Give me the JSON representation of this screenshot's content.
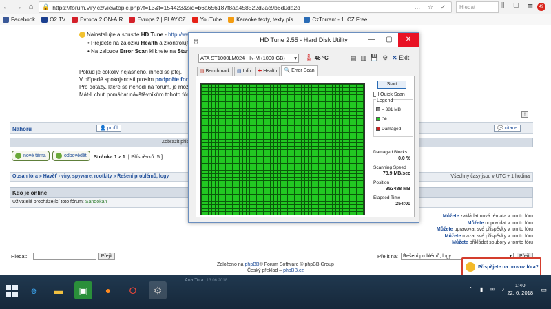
{
  "browser": {
    "url": "https://forum.viry.cz/viewtopic.php?f=13&t=154423&sid=b6a656187f8aa458522d2ac9b6d0da2d",
    "search_placeholder": "Hledat",
    "notification_count": "49"
  },
  "bookmarks": [
    {
      "label": "Facebook",
      "color": "#3b5998"
    },
    {
      "label": "O2 TV",
      "color": "#1b3f8f"
    },
    {
      "label": "Evropa 2 ON-AIR",
      "color": "#d4202a"
    },
    {
      "label": "Evropa 2 | PLAY.CZ",
      "color": "#d4202a"
    },
    {
      "label": "YouTube",
      "color": "#e62117"
    },
    {
      "label": "Karaoke texty, texty pís...",
      "color": "#f39c12"
    },
    {
      "label": "CzTorrent - 1. CZ Free ...",
      "color": "#2a6cb6"
    }
  ],
  "post": {
    "line1_prefix": "Nainstalujte a spustte",
    "line1_app": "HD Tune",
    "line1_sep": " - ",
    "line1_link": "http://www",
    "bullet1_a": "Prejdete na zalozku",
    "bullet1_b": "Health",
    "bullet1_c": "a zkontrolujte",
    "bullet2_a": "Na zalozce",
    "bullet2_b": "Error Scan",
    "bullet2_c": "kliknete na",
    "bullet2_d": "Start"
  },
  "signature": {
    "line1": "Pokud je cokoliv nejasného, ihned se ptej.",
    "line2_a": "V případě spokojenosti prosím",
    "line2_link": "podpořte forum",
    "line3": "Pro dotazy, které se nehodí na forum, je možné",
    "line4": "Mát-li chuť pomáhat návštěvníkům tohoto fóra"
  },
  "post_footer": {
    "nahoru": "Nahoru",
    "profil": "profil",
    "citace": "citace"
  },
  "show_bar": "Zobrazit příspěvky za",
  "actions": {
    "new_topic": "nové téma",
    "reply": "odpovědět",
    "page_label": "Stránka",
    "page_value": "1 z 1",
    "posts_info": "[ Příspěvků: 5 ]"
  },
  "breadcrumb": {
    "items": "Obsah fóra » Havěť - viry, spyware, rootkity » Řešení problémů, logy",
    "timezone": "Všechny časy jsou v UTC + 1 hodina"
  },
  "who": {
    "header": "Kdo je online",
    "text": "Uživatelé procházející toto fórum:",
    "user": "Sandokan"
  },
  "permissions": [
    {
      "b": "Můžete",
      "t": "zakládat nová témata v tomto fóru"
    },
    {
      "b": "Můžete",
      "t": "odpovídat v tomto fóru"
    },
    {
      "b": "Můžete",
      "t": "upravovat své příspěvky v tomto fóru"
    },
    {
      "b": "Můžete",
      "t": "mazat své příspěvky v tomto fóru"
    },
    {
      "b": "Můžete",
      "t": "přikládat soubory v tomto fóru"
    }
  ],
  "search": {
    "label": "Hledat:",
    "button": "Přejít"
  },
  "jump": {
    "label": "Přejít na:",
    "value": "Řešení problémů, logy",
    "button": "Přejít"
  },
  "footer": {
    "line1_a": "Založeno na",
    "line1_link": "phpBB",
    "line1_b": "® Forum Software © phpBB Group",
    "line2_a": "Český překlad –",
    "line2_link": "phpBB.cz"
  },
  "promo": "Přispějete na provoz fóra?",
  "hdtune": {
    "title": "HD Tune 2.55 - Hard Disk Utility",
    "drive": "ATA    ST1000LM024 HN-M (1000 GB)",
    "temperature": "46 °C",
    "exit": "Exit",
    "tabs": [
      "Benchmark",
      "Info",
      "Health",
      "Error Scan"
    ],
    "start": "Start",
    "quick_scan": "Quick Scan",
    "legend_title": "Legend",
    "legend_size": "= 381 MB",
    "legend_ok": "Ok",
    "legend_damaged": "Damaged",
    "damaged_label": "Damaged Blocks",
    "damaged_value": "0.0 %",
    "speed_label": "Scanning Speed",
    "speed_value": "78.9 MB/sec",
    "position_label": "Position",
    "position_value": "953488 MB",
    "elapsed_label": "Elapsed Time",
    "elapsed_value": "254:00",
    "colors": {
      "ok": "#22c822",
      "damaged": "#c82222"
    }
  },
  "taskbar": {
    "ghost_title": "Ana Tota...",
    "ghost_date": "13.06.2018",
    "time": "1:40",
    "date": "22. 6. 2018"
  }
}
